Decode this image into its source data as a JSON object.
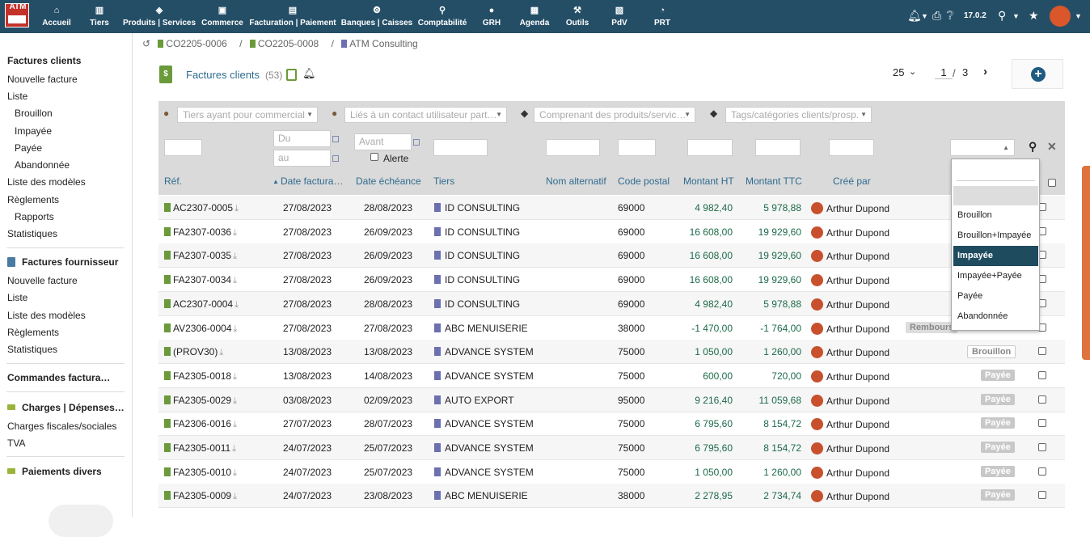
{
  "topbar": {
    "logo_text": "ATM",
    "menus": [
      {
        "label": "Accueil",
        "icon": "home-icon"
      },
      {
        "label": "Tiers",
        "icon": "building-icon"
      },
      {
        "label": "Produits | Services",
        "icon": "cube-icon"
      },
      {
        "label": "Commerce",
        "icon": "briefcase-icon"
      },
      {
        "label": "Facturation | Paiement",
        "icon": "money-icon"
      },
      {
        "label": "Banques | Caisses",
        "icon": "bank-icon"
      },
      {
        "label": "Comptabilité",
        "icon": "search-dollar-icon"
      },
      {
        "label": "GRH",
        "icon": "user-icon"
      },
      {
        "label": "Agenda",
        "icon": "calendar-icon"
      },
      {
        "label": "Outils",
        "icon": "wrench-icon"
      },
      {
        "label": "PdV",
        "icon": "cash-register-icon"
      },
      {
        "label": "PRT",
        "icon": "chart-icon"
      }
    ],
    "version": "17.0.2"
  },
  "sidebar": {
    "sec1_title": "Factures clients",
    "sec1_items": [
      "Nouvelle facture",
      "Liste",
      "Brouillon",
      "Impayée",
      "Payée",
      "Abandonnée",
      "Liste des modèles",
      "Règlements",
      "Rapports",
      "Statistiques"
    ],
    "sec2_title": "Factures fournisseur",
    "sec2_items": [
      "Nouvelle facture",
      "Liste",
      "Liste des modèles",
      "Règlements",
      "Statistiques"
    ],
    "sec3_title": "Commandes factura…",
    "sec4_title": "Charges | Dépenses…",
    "sec4_items": [
      "Charges fiscales/sociales",
      "TVA"
    ],
    "sec5_title": "Paiements divers"
  },
  "breadcrumb": [
    "CO2205-0006",
    "CO2205-0008",
    "ATM Consulting"
  ],
  "page": {
    "title": "Factures clients",
    "count": "(53)",
    "per_page": "25",
    "current_page": "1",
    "total_pages": "3"
  },
  "filters": {
    "commercial": "Tiers ayant pour commercial",
    "contact": "Liés à un contact utilisateur part…",
    "products": "Comprenant des produits/servic…",
    "tags": "Tags/catégories clients/prosp.",
    "du": "Du",
    "au": "au",
    "avant": "Avant",
    "alerte": "Alerte"
  },
  "columns": [
    "Réf.",
    "Date factura…",
    "Date échéance",
    "Tiers",
    "Nom alternatif",
    "Code postal",
    "Montant HT",
    "Montant TTC",
    "Créé par"
  ],
  "rows": [
    {
      "ref": "AC2307-0005",
      "date": "27/08/2023",
      "due": "28/08/2023",
      "tiers": "ID CONSULTING",
      "cp": "69000",
      "ht": "4 982,40",
      "ttc": "5 978,88",
      "by": "Arthur Dupond",
      "status": ""
    },
    {
      "ref": "FA2307-0036",
      "date": "27/08/2023",
      "due": "26/09/2023",
      "tiers": "ID CONSULTING",
      "cp": "69000",
      "ht": "16 608,00",
      "ttc": "19 929,60",
      "by": "Arthur Dupond",
      "status": ""
    },
    {
      "ref": "FA2307-0035",
      "date": "27/08/2023",
      "due": "26/09/2023",
      "tiers": "ID CONSULTING",
      "cp": "69000",
      "ht": "16 608,00",
      "ttc": "19 929,60",
      "by": "Arthur Dupond",
      "status": ""
    },
    {
      "ref": "FA2307-0034",
      "date": "27/08/2023",
      "due": "26/09/2023",
      "tiers": "ID CONSULTING",
      "cp": "69000",
      "ht": "16 608,00",
      "ttc": "19 929,60",
      "by": "Arthur Dupond",
      "status": ""
    },
    {
      "ref": "AC2307-0004",
      "date": "27/08/2023",
      "due": "28/08/2023",
      "tiers": "ID CONSULTING",
      "cp": "69000",
      "ht": "4 982,40",
      "ttc": "5 978,88",
      "by": "Arthur Dupond",
      "status": ""
    },
    {
      "ref": "AV2306-0004",
      "date": "27/08/2023",
      "due": "27/08/2023",
      "tiers": "ABC MENUISERIE",
      "cp": "38000",
      "ht": "-1 470,00",
      "ttc": "-1 764,00",
      "by": "Arthur Dupond",
      "status": "Rembours"
    },
    {
      "ref": "(PROV30)",
      "date": "13/08/2023",
      "due": "13/08/2023",
      "tiers": "ADVANCE SYSTEM",
      "cp": "75000",
      "ht": "1 050,00",
      "ttc": "1 260,00",
      "by": "Arthur Dupond",
      "status": "Brouillon"
    },
    {
      "ref": "FA2305-0018",
      "date": "13/08/2023",
      "due": "14/08/2023",
      "tiers": "ADVANCE SYSTEM",
      "cp": "75000",
      "ht": "600,00",
      "ttc": "720,00",
      "by": "Arthur Dupond",
      "status": "Payée"
    },
    {
      "ref": "FA2305-0029",
      "date": "03/08/2023",
      "due": "02/09/2023",
      "tiers": "AUTO EXPORT",
      "cp": "95000",
      "ht": "9 216,40",
      "ttc": "11 059,68",
      "by": "Arthur Dupond",
      "status": "Payée"
    },
    {
      "ref": "FA2306-0016",
      "date": "27/07/2023",
      "due": "28/07/2023",
      "tiers": "ADVANCE SYSTEM",
      "cp": "75000",
      "ht": "6 795,60",
      "ttc": "8 154,72",
      "by": "Arthur Dupond",
      "status": "Payée"
    },
    {
      "ref": "FA2305-0011",
      "date": "24/07/2023",
      "due": "25/07/2023",
      "tiers": "ADVANCE SYSTEM",
      "cp": "75000",
      "ht": "6 795,60",
      "ttc": "8 154,72",
      "by": "Arthur Dupond",
      "status": "Payée"
    },
    {
      "ref": "FA2305-0010",
      "date": "24/07/2023",
      "due": "25/07/2023",
      "tiers": "ADVANCE SYSTEM",
      "cp": "75000",
      "ht": "1 050,00",
      "ttc": "1 260,00",
      "by": "Arthur Dupond",
      "status": "Payée"
    },
    {
      "ref": "FA2305-0009",
      "date": "24/07/2023",
      "due": "23/08/2023",
      "tiers": "ABC MENUISERIE",
      "cp": "38000",
      "ht": "2 278,95",
      "ttc": "2 734,74",
      "by": "Arthur Dupond",
      "status": "Payée"
    }
  ],
  "status_dropdown": {
    "options": [
      "Brouillon",
      "Brouillon+Impayée",
      "Impayée",
      "Impayée+Payée",
      "Payée",
      "Abandonnée"
    ],
    "highlighted": "Impayée"
  },
  "colors": {
    "topbar": "#244e66",
    "accent": "#2f6b8f",
    "amount": "#1d6a49",
    "highlight": "#1f4b5f"
  }
}
